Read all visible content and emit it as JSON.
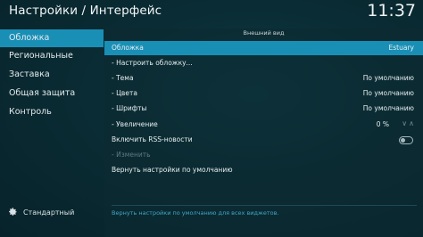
{
  "header": {
    "title": "Настройки / Интерфейс",
    "clock": "11:37"
  },
  "sidebar": {
    "items": [
      {
        "label": "Обложка",
        "active": true
      },
      {
        "label": "Региональные"
      },
      {
        "label": "Заставка"
      },
      {
        "label": "Общая защита"
      },
      {
        "label": "Контроль"
      }
    ],
    "level": "Стандартный"
  },
  "content": {
    "section_title": "Внешний вид",
    "rows": [
      {
        "label": "Обложка",
        "value": "Estuary"
      },
      {
        "label": "- Настроить обложку...",
        "value": ""
      },
      {
        "label": "- Тема",
        "value": "По умолчанию"
      },
      {
        "label": "- Цвета",
        "value": "По умолчанию"
      },
      {
        "label": "- Шрифты",
        "value": "По умолчанию"
      },
      {
        "label": "- Увеличение",
        "value": "0 %"
      },
      {
        "label": "Включить RSS-новости",
        "value": ""
      },
      {
        "label": "- Изменить",
        "value": ""
      },
      {
        "label": "Вернуть настройки по умолчанию",
        "value": ""
      }
    ],
    "hint": "Вернуть настройки по умолчанию для всех виджетов."
  }
}
